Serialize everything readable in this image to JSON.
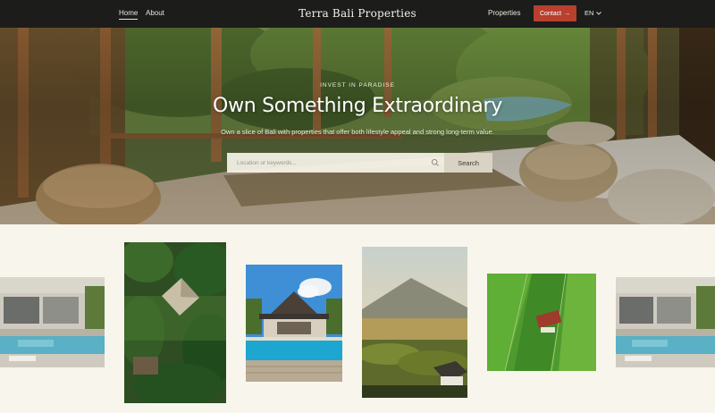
{
  "nav": {
    "links": [
      {
        "label": "Home",
        "active": true
      },
      {
        "label": "About",
        "active": false
      }
    ],
    "brand": "Terra Bali Properties",
    "properties_label": "Properties",
    "contact_label": "Contact",
    "language": "EN"
  },
  "hero": {
    "eyebrow": "INVEST IN PARADISE",
    "headline": "Own Something Extraordinary",
    "subline": "Own a slice of Bali with properties that offer both lifestyle appeal and strong long-term value.",
    "search": {
      "placeholder": "Location or keywords...",
      "button_label": "Search"
    }
  },
  "gallery": {
    "images": [
      {
        "name": "modern-villa-pool-photo"
      },
      {
        "name": "jungle-villa-aerial-photo"
      },
      {
        "name": "joglo-villa-pool-photo"
      },
      {
        "name": "mountain-rice-terrace-photo"
      },
      {
        "name": "rice-field-aerial-photo"
      },
      {
        "name": "modern-villa-pool-photo-2"
      }
    ]
  },
  "colors": {
    "nav_bg": "#1c1c1a",
    "accent": "#b8402f",
    "page_bg": "#f8f6ec"
  }
}
